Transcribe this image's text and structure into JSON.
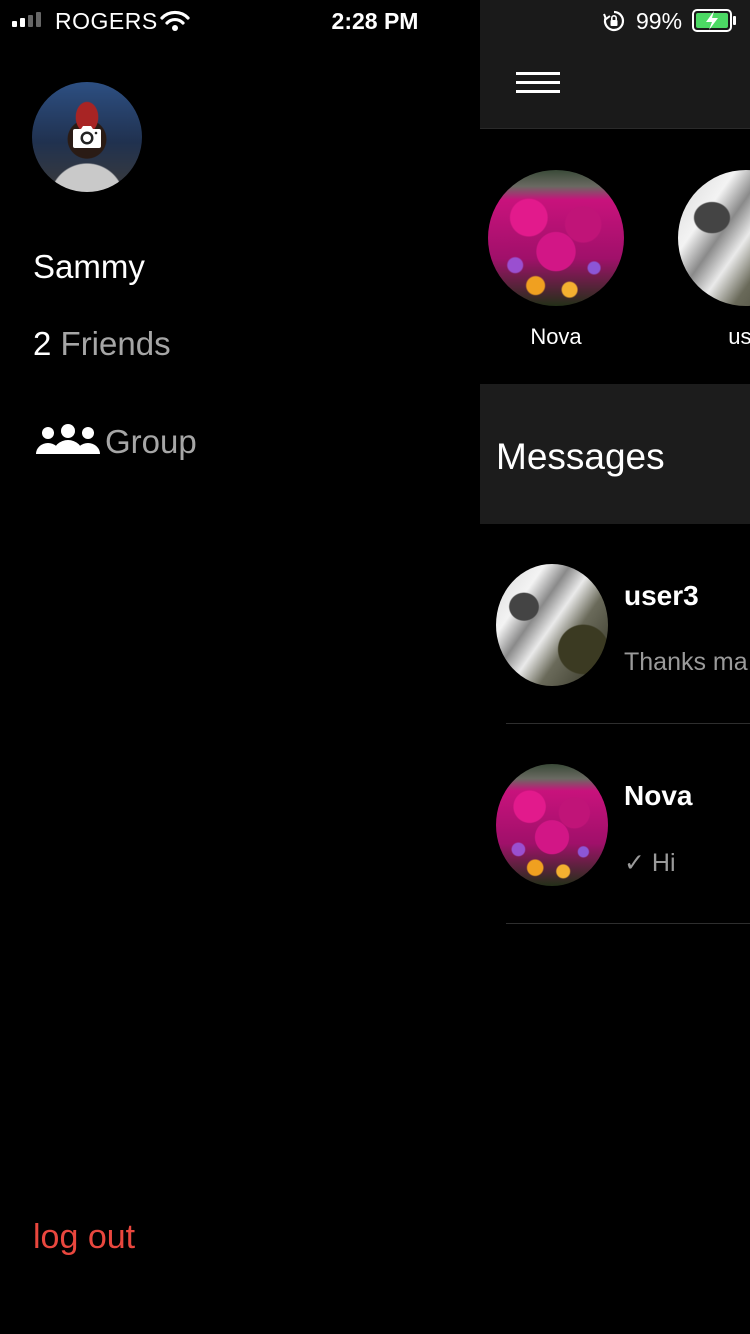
{
  "status_bar": {
    "carrier": "ROGERS",
    "time": "2:28 PM",
    "battery_percent": "99%",
    "signal_bars_active": 2,
    "icons": [
      "signal-icon",
      "wifi-icon",
      "orientation-lock-icon",
      "battery-charging-icon"
    ]
  },
  "drawer": {
    "profile": {
      "name": "Sammy",
      "avatar_overlay_icon": "camera-icon"
    },
    "friends": {
      "count": "2",
      "label": "Friends"
    },
    "group": {
      "icon": "group-icon",
      "label": "Group"
    },
    "logout_label": "log out"
  },
  "main": {
    "menu_icon": "hamburger-icon",
    "stories": [
      {
        "label": "Nova",
        "avatar": "flowers"
      },
      {
        "label": "use",
        "avatar": "waterfall"
      }
    ],
    "messages_title": "Messages",
    "conversations": [
      {
        "name": "user3",
        "preview": "Thanks ma",
        "avatar": "waterfall"
      },
      {
        "name": "Nova",
        "preview": "✓ Hi",
        "avatar": "flowers"
      }
    ]
  },
  "colors": {
    "background": "#000000",
    "panel": "#1a1a1a",
    "muted_text": "#a6a6a6",
    "logout": "#e9473e",
    "battery_fill": "#4cd964"
  }
}
